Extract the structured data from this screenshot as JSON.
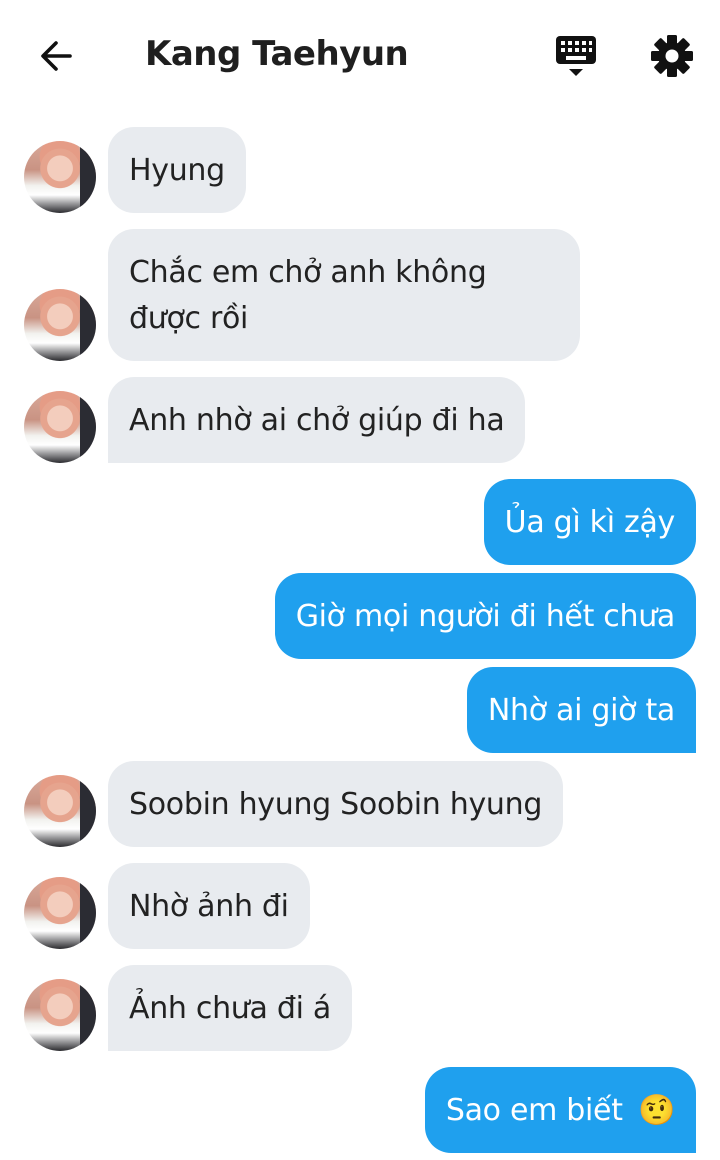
{
  "header": {
    "title": "Kang Taehyun",
    "back_icon": "arrow-left-icon",
    "keyboard_icon": "keyboard-icon",
    "settings_icon": "gear-icon"
  },
  "messages": [
    {
      "side": "in",
      "text": "Hyung"
    },
    {
      "side": "in",
      "line1": "Chắc em chở anh không",
      "line2": "được rồi"
    },
    {
      "side": "in",
      "text": "Anh nhờ ai chở giúp đi ha"
    },
    {
      "side": "out",
      "text": "Ủa gì kì zậy"
    },
    {
      "side": "out",
      "text": "Giờ mọi người đi hết chưa"
    },
    {
      "side": "out",
      "text": "Nhờ ai giờ ta"
    },
    {
      "side": "in",
      "text": "Soobin hyung Soobin hyung"
    },
    {
      "side": "in",
      "text": "Nhờ ảnh đi"
    },
    {
      "side": "in",
      "text": "Ảnh chưa đi á"
    },
    {
      "side": "out",
      "text": "Sao em biết",
      "emoji": "🤨"
    }
  ],
  "colors": {
    "incoming_bubble": "#e8ebef",
    "outgoing_bubble": "#1fa0ee"
  }
}
